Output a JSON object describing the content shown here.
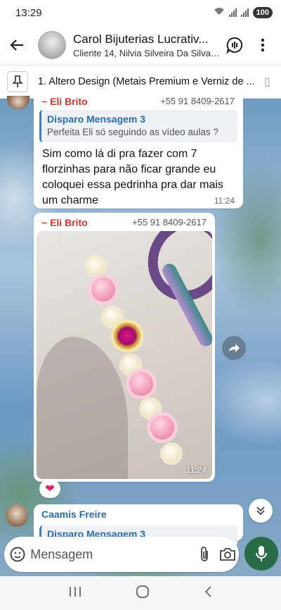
{
  "status": {
    "time": "13:29",
    "battery": "100"
  },
  "header": {
    "title": "Carol Bijuterias Lucrativ...",
    "subtitle": "Cliente 14, Nilvia Silveira Da Silva,..."
  },
  "pinned": {
    "text": "1. Altero Design (Metais Premium e Verniz de ..."
  },
  "messages": [
    {
      "sender": "~ Eli Brito",
      "phone": "+55 91 8409-2617",
      "quote_name": "Disparo Mensagem 3",
      "quote_text": "Perfeita Eli só seguindo as vídeo aulas ?",
      "text": "Sim como lá di pra fazer com 7 florzinhas para não ficar grande eu coloquei essa pedrinha pra dar mais um charme",
      "time": "11:24"
    },
    {
      "sender": "~ Eli Brito",
      "phone": "+55 91 8409-2617",
      "time": "11:24",
      "reaction": "❤"
    },
    {
      "sender": "Caamis Freire",
      "quote_name": "Disparo Mensagem 3"
    }
  ],
  "composer": {
    "placeholder": "Mensagem"
  },
  "icons": [
    "back-arrow-icon",
    "voice-chat-icon",
    "more-vert-icon",
    "pin-icon",
    "share-forward-icon",
    "chevron-double-down-icon",
    "sticker-icon",
    "attach-icon",
    "camera-icon",
    "mic-icon",
    "nav-recent-icon",
    "nav-home-icon",
    "nav-back-icon"
  ],
  "colors": {
    "sender_red": "#d8322e",
    "link_blue": "#2b6cb0",
    "mic_green": "#2a6b47"
  }
}
